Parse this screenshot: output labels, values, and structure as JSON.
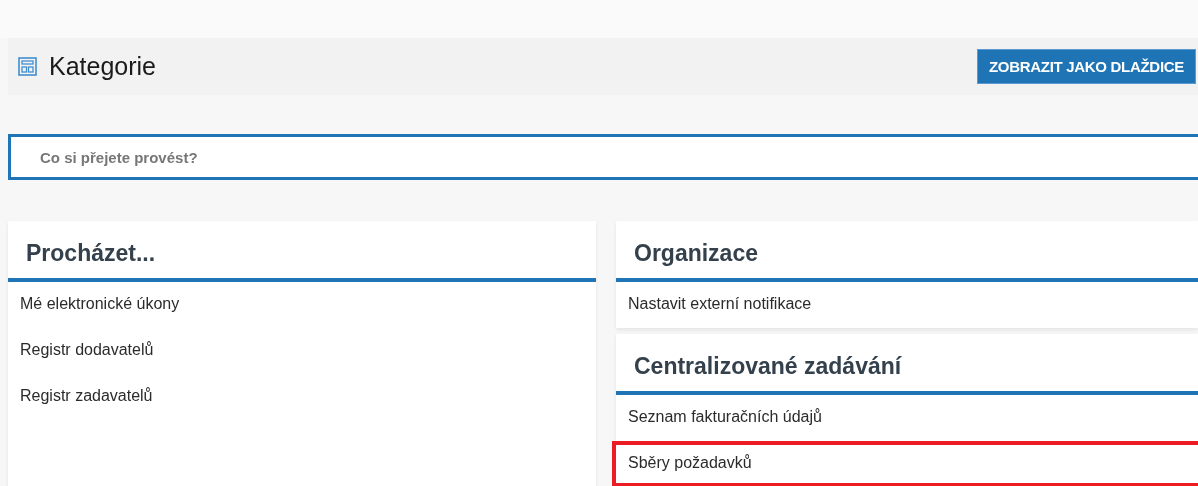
{
  "header": {
    "title": "Kategorie",
    "button": "ZOBRAZIT JAKO DLAŽDICE"
  },
  "search": {
    "placeholder": "Co si přejete provést?"
  },
  "columns": [
    {
      "cards": [
        {
          "title": "Procházet...",
          "items": [
            {
              "label": "Mé elektronické úkony",
              "highlighted": false
            },
            {
              "label": "Registr dodavatelů",
              "highlighted": false
            },
            {
              "label": "Registr zadavatelů",
              "highlighted": false
            }
          ]
        }
      ]
    },
    {
      "cards": [
        {
          "title": "Organizace",
          "items": [
            {
              "label": "Nastavit externí notifikace",
              "highlighted": false
            }
          ]
        },
        {
          "title": "Centralizované zadávání",
          "items": [
            {
              "label": "Seznam fakturačních údajů",
              "highlighted": false
            },
            {
              "label": "Sběry požadavků",
              "highlighted": true
            }
          ]
        }
      ]
    }
  ]
}
